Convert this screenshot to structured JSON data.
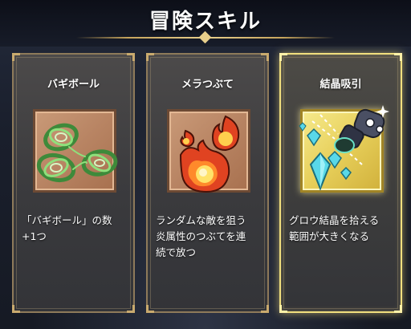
{
  "screen": {
    "title": "冒険スキル"
  },
  "cards": [
    {
      "name": "バギボール",
      "description_lines": [
        "「バギボール」の数",
        "+1つ"
      ],
      "icon": "wind-ball-icon",
      "selected": false
    },
    {
      "name": "メラつぶて",
      "description_lines": [
        "ランダムな敵を狙う",
        "炎属性のつぶてを連",
        "続で放つ"
      ],
      "icon": "fireball-icon",
      "selected": false
    },
    {
      "name": "結晶吸引",
      "description_lines": [
        "グロウ結晶を拾える",
        "範囲が大きくなる"
      ],
      "icon": "crystal-vacuum-icon",
      "selected": true
    }
  ],
  "colors": {
    "selected_border": "#f1df7e",
    "frame_gold": "#c9aa6e",
    "card_art_bg": "#b88463",
    "card_art_selected_bg": "#e7cf5a"
  }
}
